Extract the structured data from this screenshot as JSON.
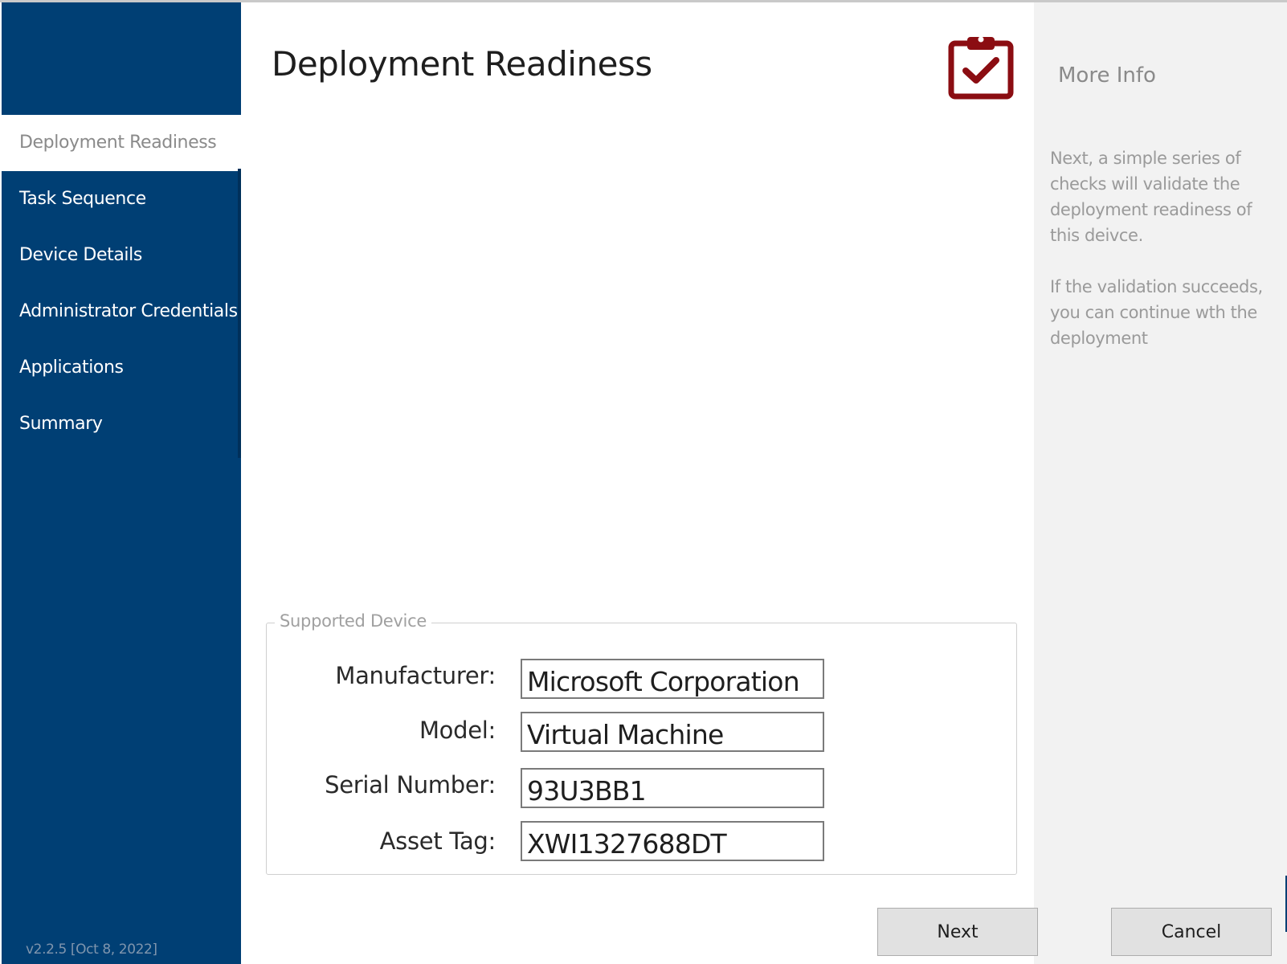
{
  "window": {
    "title": "Deployment Readiness",
    "version": "v2.2.5 [Oct 8, 2022]"
  },
  "sidebar": {
    "items": [
      {
        "label": "Deployment Readiness",
        "active": true
      },
      {
        "label": "Task Sequence",
        "active": false
      },
      {
        "label": "Device Details",
        "active": false
      },
      {
        "label": "Administrator Credentials",
        "active": false
      },
      {
        "label": "Applications",
        "active": false
      },
      {
        "label": "Summary",
        "active": false
      }
    ]
  },
  "header": {
    "icon": "clipboard-check-icon",
    "icon_color": "#8b0d12"
  },
  "info": {
    "title": "More Info",
    "paragraphs": [
      "Next, a simple series of checks will validate the deployment readiness of this deivce.",
      "If the validation succeeds, you can continue wth the deployment"
    ]
  },
  "supported_device": {
    "legend": "Supported Device",
    "fields": [
      {
        "label": "Manufacturer:",
        "value": "Microsoft Corporation"
      },
      {
        "label": "Model:",
        "value": "Virtual Machine"
      },
      {
        "label": "Serial Number:",
        "value": "93U3BB1"
      },
      {
        "label": "Asset Tag:",
        "value": "XWI1327688DT"
      }
    ]
  },
  "buttons": {
    "next": "Next",
    "cancel": "Cancel"
  },
  "colors": {
    "sidebar": "#003f74",
    "info_panel": "#f2f2f2",
    "accent": "#8b0d12"
  }
}
